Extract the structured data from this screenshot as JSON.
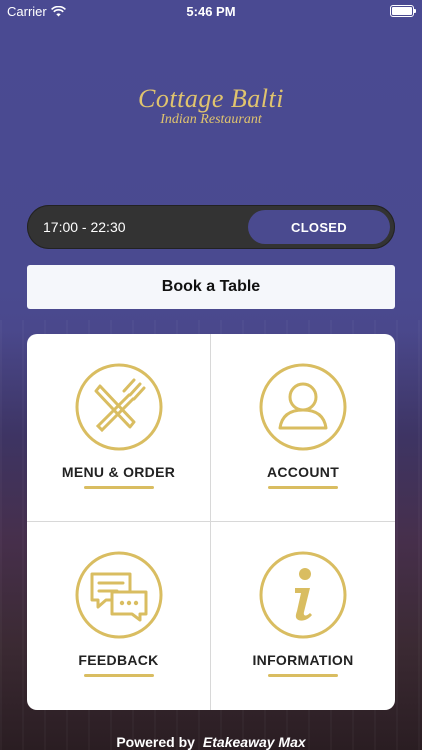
{
  "status_bar": {
    "carrier": "Carrier",
    "time": "5:46 PM"
  },
  "logo": {
    "name": "Cottage Balti",
    "subtitle": "Indian Restaurant"
  },
  "hours": {
    "times": "17:00 - 22:30",
    "status": "CLOSED"
  },
  "book": {
    "label": "Book a Table"
  },
  "tiles": [
    {
      "label": "MENU & ORDER",
      "icon": "fork-knife-icon"
    },
    {
      "label": "ACCOUNT",
      "icon": "user-icon"
    },
    {
      "label": "FEEDBACK",
      "icon": "chat-bubbles-icon"
    },
    {
      "label": "INFORMATION",
      "icon": "info-icon"
    }
  ],
  "footer": {
    "powered_by": "Powered by",
    "brand": "Etakeaway Max"
  },
  "colors": {
    "accent": "#d9bd61",
    "primary": "#4a4a8f"
  }
}
